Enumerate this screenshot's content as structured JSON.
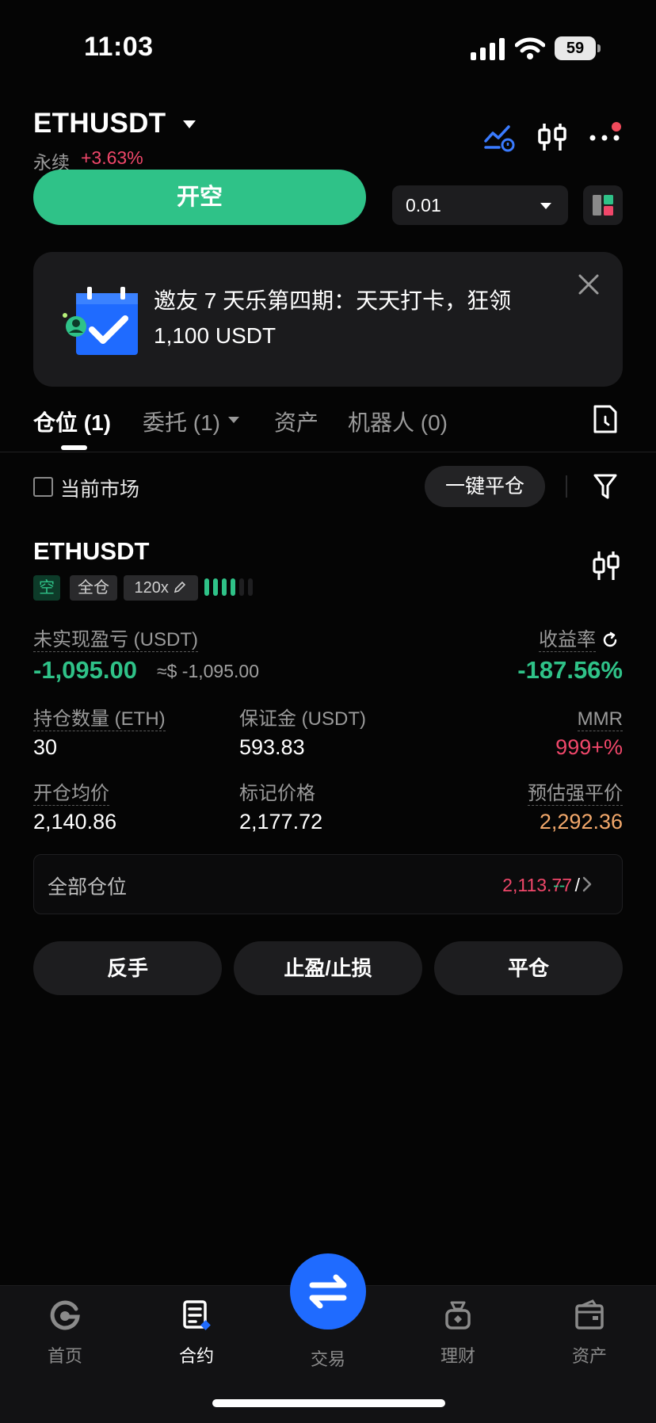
{
  "status_bar": {
    "time": "11:03",
    "battery": "59"
  },
  "header": {
    "pair": "ETHUSDT",
    "type": "永续",
    "change": "+3.63%"
  },
  "order": {
    "open_short_label": "开空",
    "quantity": "0.01"
  },
  "banner": {
    "line1": "邀友 7 天乐第四期：天天打卡，狂领",
    "line2": "1,100 USDT"
  },
  "tabs": [
    {
      "label": "仓位 (1)"
    },
    {
      "label": "委托 (1)"
    },
    {
      "label": "资产"
    },
    {
      "label": "机器人 (0)"
    }
  ],
  "filter": {
    "current_market": "当前市场",
    "close_all": "一键平仓"
  },
  "position": {
    "symbol": "ETHUSDT",
    "side_tag": "空",
    "margin_mode": "全仓",
    "leverage": "120x",
    "unrealized_label": "未实现盈亏 (USDT)",
    "unrealized_value": "-1,095.00",
    "unrealized_approx": "≈$ -1,095.00",
    "roe_label": "收益率",
    "roe_value": "-187.56%",
    "size_label": "持仓数量 (ETH)",
    "size_value": "30",
    "margin_label": "保证金 (USDT)",
    "margin_value": "593.83",
    "mmr_label": "MMR",
    "mmr_value": "999+%",
    "entry_label": "开仓均价",
    "entry_value": "2,140.86",
    "mark_label": "标记价格",
    "mark_value": "2,177.72",
    "liq_label": "预估强平价",
    "liq_value": "2,292.36",
    "all_positions_label": "全部仓位",
    "all_positions_price": "2,113.77",
    "all_positions_sep": "/",
    "all_positions_other": "--",
    "actions": {
      "reverse": "反手",
      "tpsl": "止盈/止损",
      "close": "平仓"
    }
  },
  "bottom_nav": [
    {
      "label": "首页"
    },
    {
      "label": "合约"
    },
    {
      "label": "交易"
    },
    {
      "label": "理财"
    },
    {
      "label": "资产"
    }
  ],
  "colors": {
    "green": "#2fc288",
    "red": "#f0476a",
    "orange": "#f2a86b",
    "blue": "#1f6bff",
    "background": "#050505"
  },
  "icons": {
    "header": [
      "trend-icon",
      "candlestick-icon",
      "more-icon"
    ],
    "banner": "calendar-check-icon",
    "nav": [
      "home-icon",
      "contract-icon",
      "swap-icon",
      "finance-icon",
      "wallet-icon"
    ]
  }
}
